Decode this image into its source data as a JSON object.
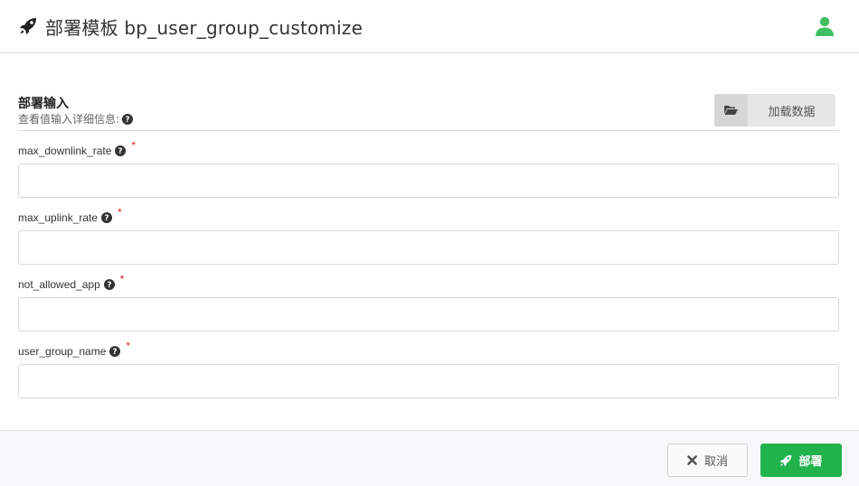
{
  "header": {
    "title": "部署模板 bp_user_group_customize",
    "icon": "rocket-icon",
    "user_icon": "user-icon",
    "user_icon_color": "#3fbe62"
  },
  "section": {
    "title": "部署输入",
    "subtitle": "查看值输入详细信息:",
    "load_button_label": "加载数据",
    "load_button_icon": "folder-open-icon"
  },
  "fields": [
    {
      "label": "max_downlink_rate",
      "required_mark": "*",
      "value": "",
      "placeholder": ""
    },
    {
      "label": "max_uplink_rate",
      "required_mark": "*",
      "value": "",
      "placeholder": ""
    },
    {
      "label": "not_allowed_app",
      "required_mark": "*",
      "value": "",
      "placeholder": ""
    },
    {
      "label": "user_group_name",
      "required_mark": "*",
      "value": "",
      "placeholder": ""
    }
  ],
  "footer": {
    "cancel_label": "取消",
    "deploy_label": "部署",
    "deploy_color": "#22b24c"
  }
}
